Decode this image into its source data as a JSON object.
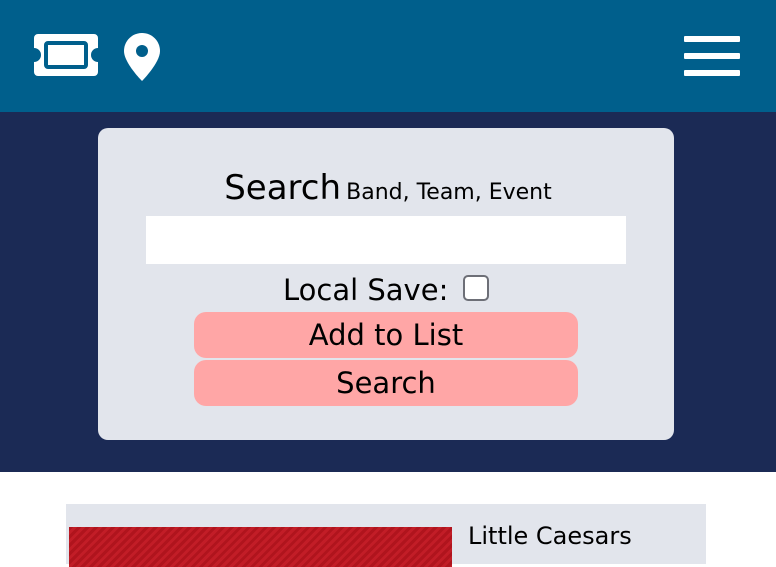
{
  "header": {
    "ticket_icon": "ticket-icon",
    "location_icon": "map-pin-icon",
    "menu_icon": "hamburger-menu-icon",
    "background_color": "#005f8c"
  },
  "hero": {
    "background_color": "#1b2a55"
  },
  "search": {
    "heading": "Search",
    "subheading": "Band, Team, Event",
    "input_value": "",
    "input_placeholder": "",
    "local_save_label": "Local Save:",
    "local_save_checked": false,
    "add_button_label": "Add to List",
    "search_button_label": "Search",
    "button_color": "#ffa6a6"
  },
  "results": [
    {
      "title": "Little Caesars"
    }
  ]
}
